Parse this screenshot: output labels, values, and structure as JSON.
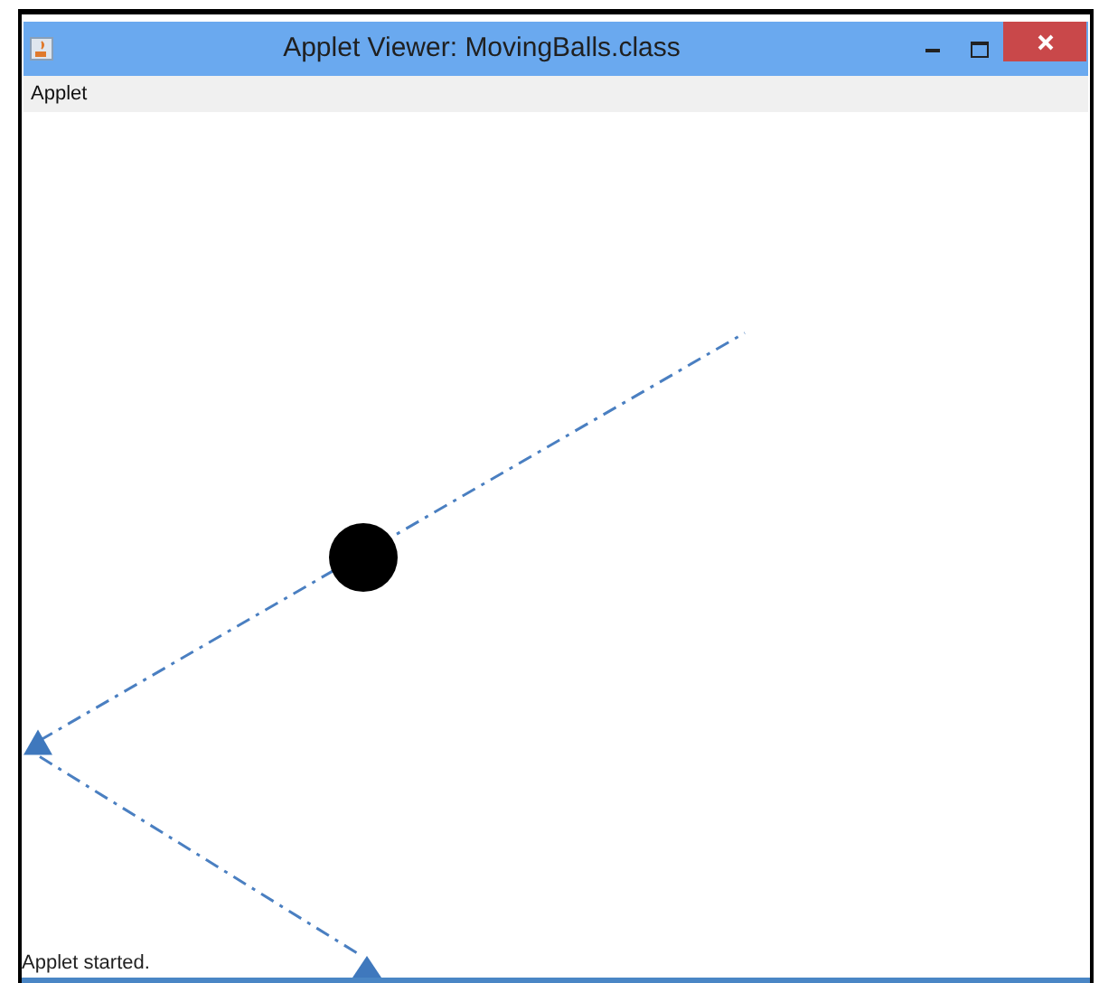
{
  "window": {
    "title": "Applet Viewer: MovingBalls.class"
  },
  "menu": [
    {
      "label": "Applet"
    }
  ],
  "status_bar": "Applet started."
}
